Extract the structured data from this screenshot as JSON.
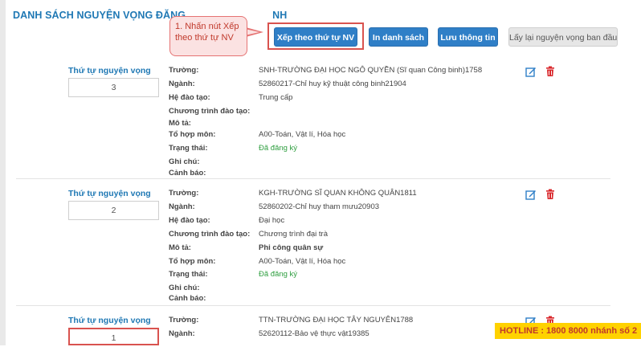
{
  "page": {
    "title": "DANH SÁCH NGUYỆN VỌNG ĐĂNG",
    "title_tail": "NH"
  },
  "toolbar": {
    "sort_label": "Xếp theo thứ tự NV",
    "print_label": "In danh sách",
    "save_label": "Lưu thông tin",
    "reset_label": "Lấy lại nguyện vọng ban đầu"
  },
  "callout": {
    "line1": "1. Nhấn nút Xếp",
    "line2": "theo thứ tự NV"
  },
  "labels": {
    "order": "Thứ tự nguyện vọng",
    "school": "Trường:",
    "major": "Ngành:",
    "training": "Hệ đào tạo:",
    "program": "Chương trình đào tạo:",
    "description": "Mô tả:",
    "combo": "Tổ hợp môn:",
    "status": "Trạng thái:",
    "note": "Ghi chú:",
    "warning": "Cảnh báo:"
  },
  "records": [
    {
      "order": "3",
      "school": "SNH-TRƯỜNG ĐẠI HỌC NGÔ QUYỀN (Sĩ quan Công binh)1758",
      "major": "52860217-Chỉ huy kỹ thuật công binh21904",
      "training": "Trung cấp",
      "program": "",
      "description": "",
      "combo": "A00-Toán, Vật lí, Hóa học",
      "status": "Đã đăng ký",
      "note": "",
      "warning": ""
    },
    {
      "order": "2",
      "school": "KGH-TRƯỜNG SĨ QUAN KHÔNG QUÂN1811",
      "major": "52860202-Chỉ huy tham mưu20903",
      "training": "Đại học",
      "program": "Chương trình đại trà",
      "description": "Phi công quân sự",
      "combo": "A00-Toán, Vật lí, Hóa học",
      "status": "Đã đăng ký",
      "note": "",
      "warning": ""
    },
    {
      "order": "1",
      "school": "TTN-TRƯỜNG ĐẠI HỌC TÂY NGUYÊN1788",
      "major": "52620112-Bảo vệ thực vật19385"
    }
  ],
  "hotline": "HOTLINE : 1800 8000 nhánh số 2",
  "colors": {
    "accent": "#2f7fc7",
    "title": "#1f78b4",
    "status_ok": "#2e9e3f",
    "highlight": "#d9534f",
    "hotline_bg": "#ffd200"
  },
  "icons": [
    "edit-icon",
    "trash-icon"
  ]
}
